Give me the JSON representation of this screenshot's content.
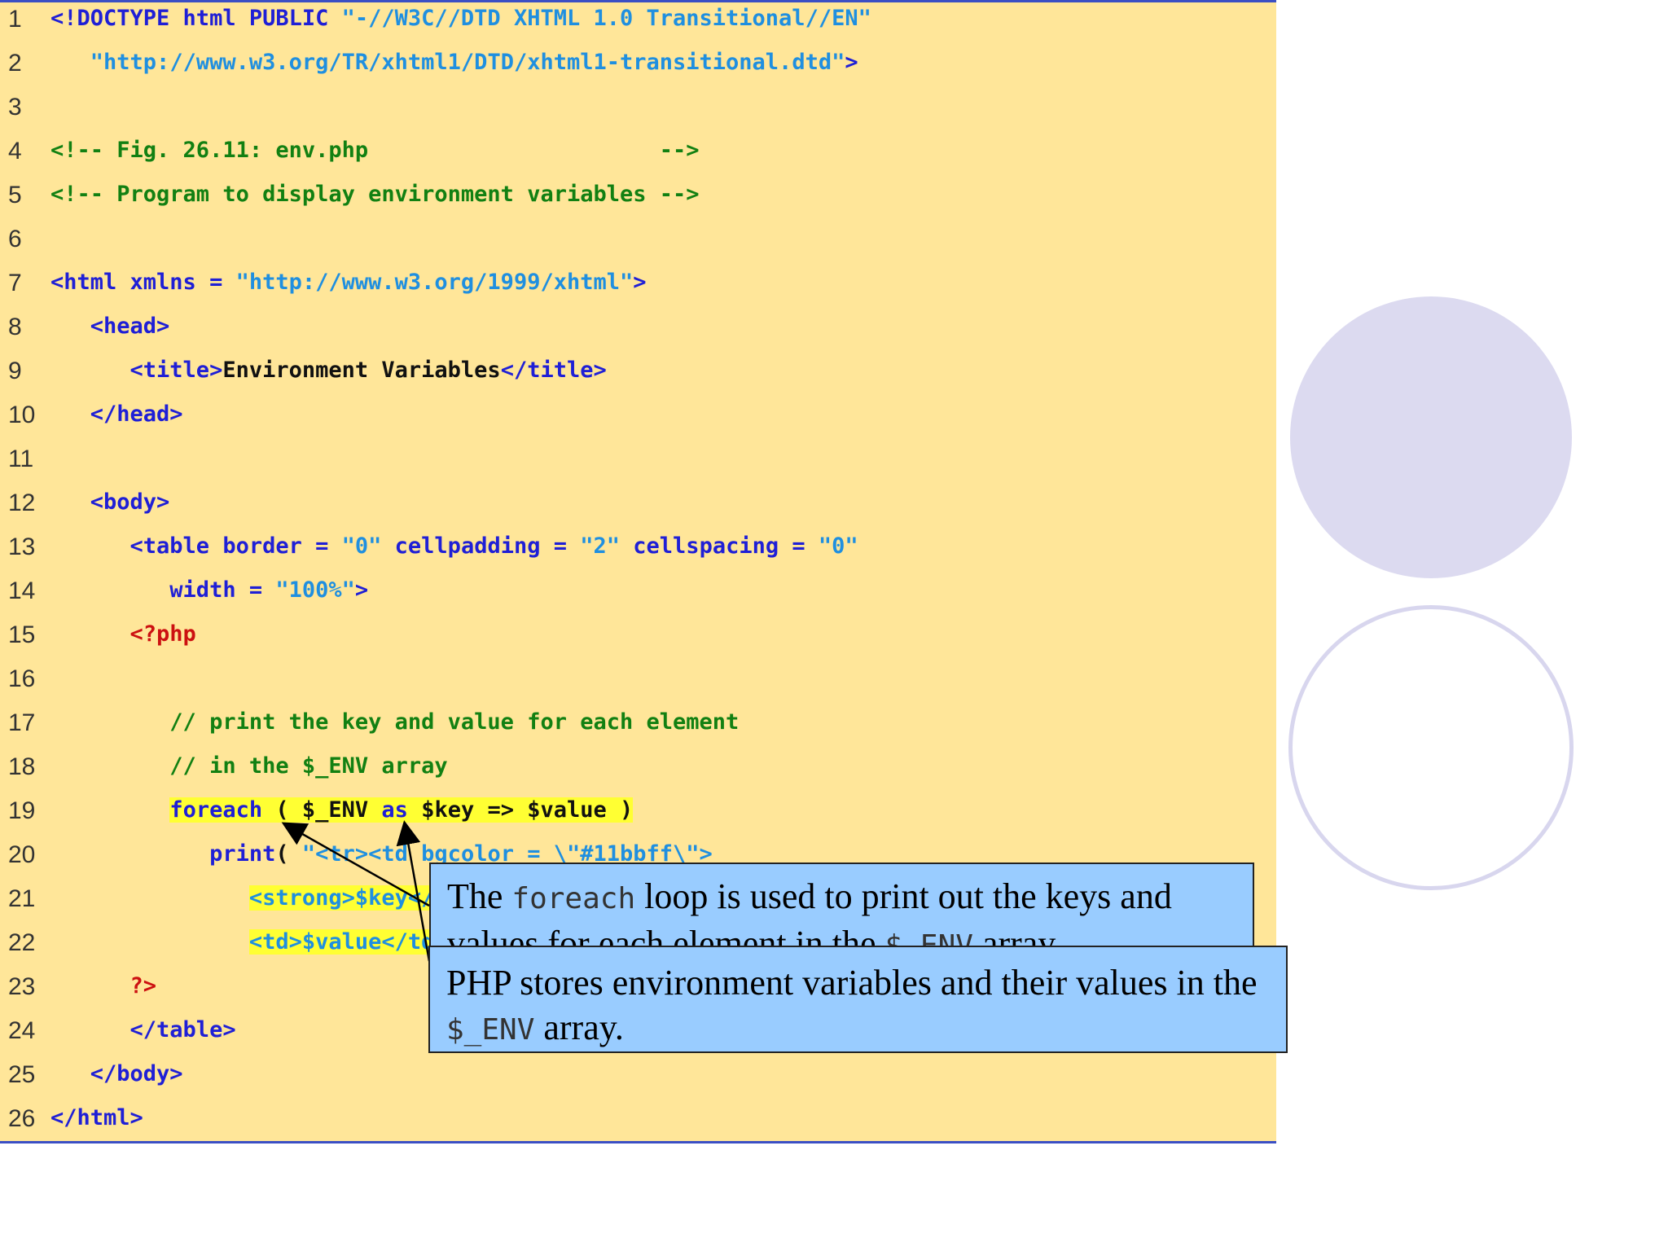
{
  "code_lines": [
    {
      "num": "1",
      "parts": [
        {
          "t": "<!DOCTYPE html PUBLIC ",
          "c": "tag"
        },
        {
          "t": "\"-//W3C//DTD XHTML 1.0 Transitional//EN\"",
          "c": "str"
        }
      ]
    },
    {
      "num": "2",
      "parts": [
        {
          "t": "   ",
          "c": "txt"
        },
        {
          "t": "\"http://www.w3.org/TR/xhtml1/DTD/xhtml1-transitional.dtd\"",
          "c": "str"
        },
        {
          "t": ">",
          "c": "tag"
        }
      ]
    },
    {
      "num": "3",
      "parts": []
    },
    {
      "num": "4",
      "parts": [
        {
          "t": "<!-- Fig. 26.11: env.php                      -->",
          "c": "cmt"
        }
      ]
    },
    {
      "num": "5",
      "parts": [
        {
          "t": "<!-- Program to display environment variables -->",
          "c": "cmt"
        }
      ]
    },
    {
      "num": "6",
      "parts": []
    },
    {
      "num": "7",
      "parts": [
        {
          "t": "<html xmlns = ",
          "c": "tag"
        },
        {
          "t": "\"http://www.w3.org/1999/xhtml\"",
          "c": "str"
        },
        {
          "t": ">",
          "c": "tag"
        }
      ]
    },
    {
      "num": "8",
      "parts": [
        {
          "t": "   <head>",
          "c": "tag"
        }
      ]
    },
    {
      "num": "9",
      "parts": [
        {
          "t": "      <title>",
          "c": "tag"
        },
        {
          "t": "Environment Variables",
          "c": "txt"
        },
        {
          "t": "</title>",
          "c": "tag"
        }
      ]
    },
    {
      "num": "10",
      "parts": [
        {
          "t": "   </head>",
          "c": "tag"
        }
      ]
    },
    {
      "num": "11",
      "parts": []
    },
    {
      "num": "12",
      "parts": [
        {
          "t": "   <body>",
          "c": "tag"
        }
      ]
    },
    {
      "num": "13",
      "parts": [
        {
          "t": "      <table border = ",
          "c": "tag"
        },
        {
          "t": "\"0\"",
          "c": "str"
        },
        {
          "t": " cellpadding = ",
          "c": "tag"
        },
        {
          "t": "\"2\"",
          "c": "str"
        },
        {
          "t": " cellspacing = ",
          "c": "tag"
        },
        {
          "t": "\"0\"",
          "c": "str"
        }
      ]
    },
    {
      "num": "14",
      "parts": [
        {
          "t": "         width = ",
          "c": "tag"
        },
        {
          "t": "\"100%\"",
          "c": "str"
        },
        {
          "t": ">",
          "c": "tag"
        }
      ]
    },
    {
      "num": "15",
      "parts": [
        {
          "t": "      <?php",
          "c": "php"
        }
      ]
    },
    {
      "num": "16",
      "parts": []
    },
    {
      "num": "17",
      "parts": [
        {
          "t": "         // print the key and value for each element",
          "c": "cmt"
        }
      ]
    },
    {
      "num": "18",
      "parts": [
        {
          "t": "         // in the $_ENV array",
          "c": "cmt"
        }
      ]
    },
    {
      "num": "19",
      "parts": [
        {
          "t": "         ",
          "c": "txt"
        },
        {
          "t": "foreach",
          "c": "kw hl"
        },
        {
          "t": " ( $_ENV ",
          "c": "var hl"
        },
        {
          "t": "as",
          "c": "kw hl"
        },
        {
          "t": " $key => $value )",
          "c": "var hl"
        }
      ]
    },
    {
      "num": "20",
      "parts": [
        {
          "t": "            ",
          "c": "txt"
        },
        {
          "t": "print",
          "c": "kw"
        },
        {
          "t": "( ",
          "c": "var"
        },
        {
          "t": "\"<tr><td bgcolor = \\\"#11bbff\\\">",
          "c": "str"
        }
      ]
    },
    {
      "num": "21",
      "parts": [
        {
          "t": "               ",
          "c": "txt"
        },
        {
          "t": "<strong>$key</strong></td>",
          "c": "hl2"
        }
      ]
    },
    {
      "num": "22",
      "parts": [
        {
          "t": "               ",
          "c": "txt"
        },
        {
          "t": "<td>$value</td></tr>\" );",
          "c": "hl2"
        }
      ]
    },
    {
      "num": "23",
      "parts": [
        {
          "t": "      ?>",
          "c": "php"
        }
      ]
    },
    {
      "num": "24",
      "parts": [
        {
          "t": "      </table>",
          "c": "tag"
        }
      ]
    },
    {
      "num": "25",
      "parts": [
        {
          "t": "   </body>",
          "c": "tag"
        }
      ]
    },
    {
      "num": "26",
      "parts": [
        {
          "t": "</html>",
          "c": "tag"
        }
      ]
    }
  ],
  "callout_1": {
    "pre": "The ",
    "code": "foreach",
    "post": " loop is used to print out the keys and values for each element in the ",
    "code2": "$_ENV",
    "post2": " array."
  },
  "callout_2": {
    "pre": "PHP stores environment variables and their values in the ",
    "code": "$_ENV",
    "post": " array."
  },
  "colors": {
    "panel_bg": "#ffe699",
    "callout_bg": "#99ccff",
    "highlight": "#ffff33"
  }
}
